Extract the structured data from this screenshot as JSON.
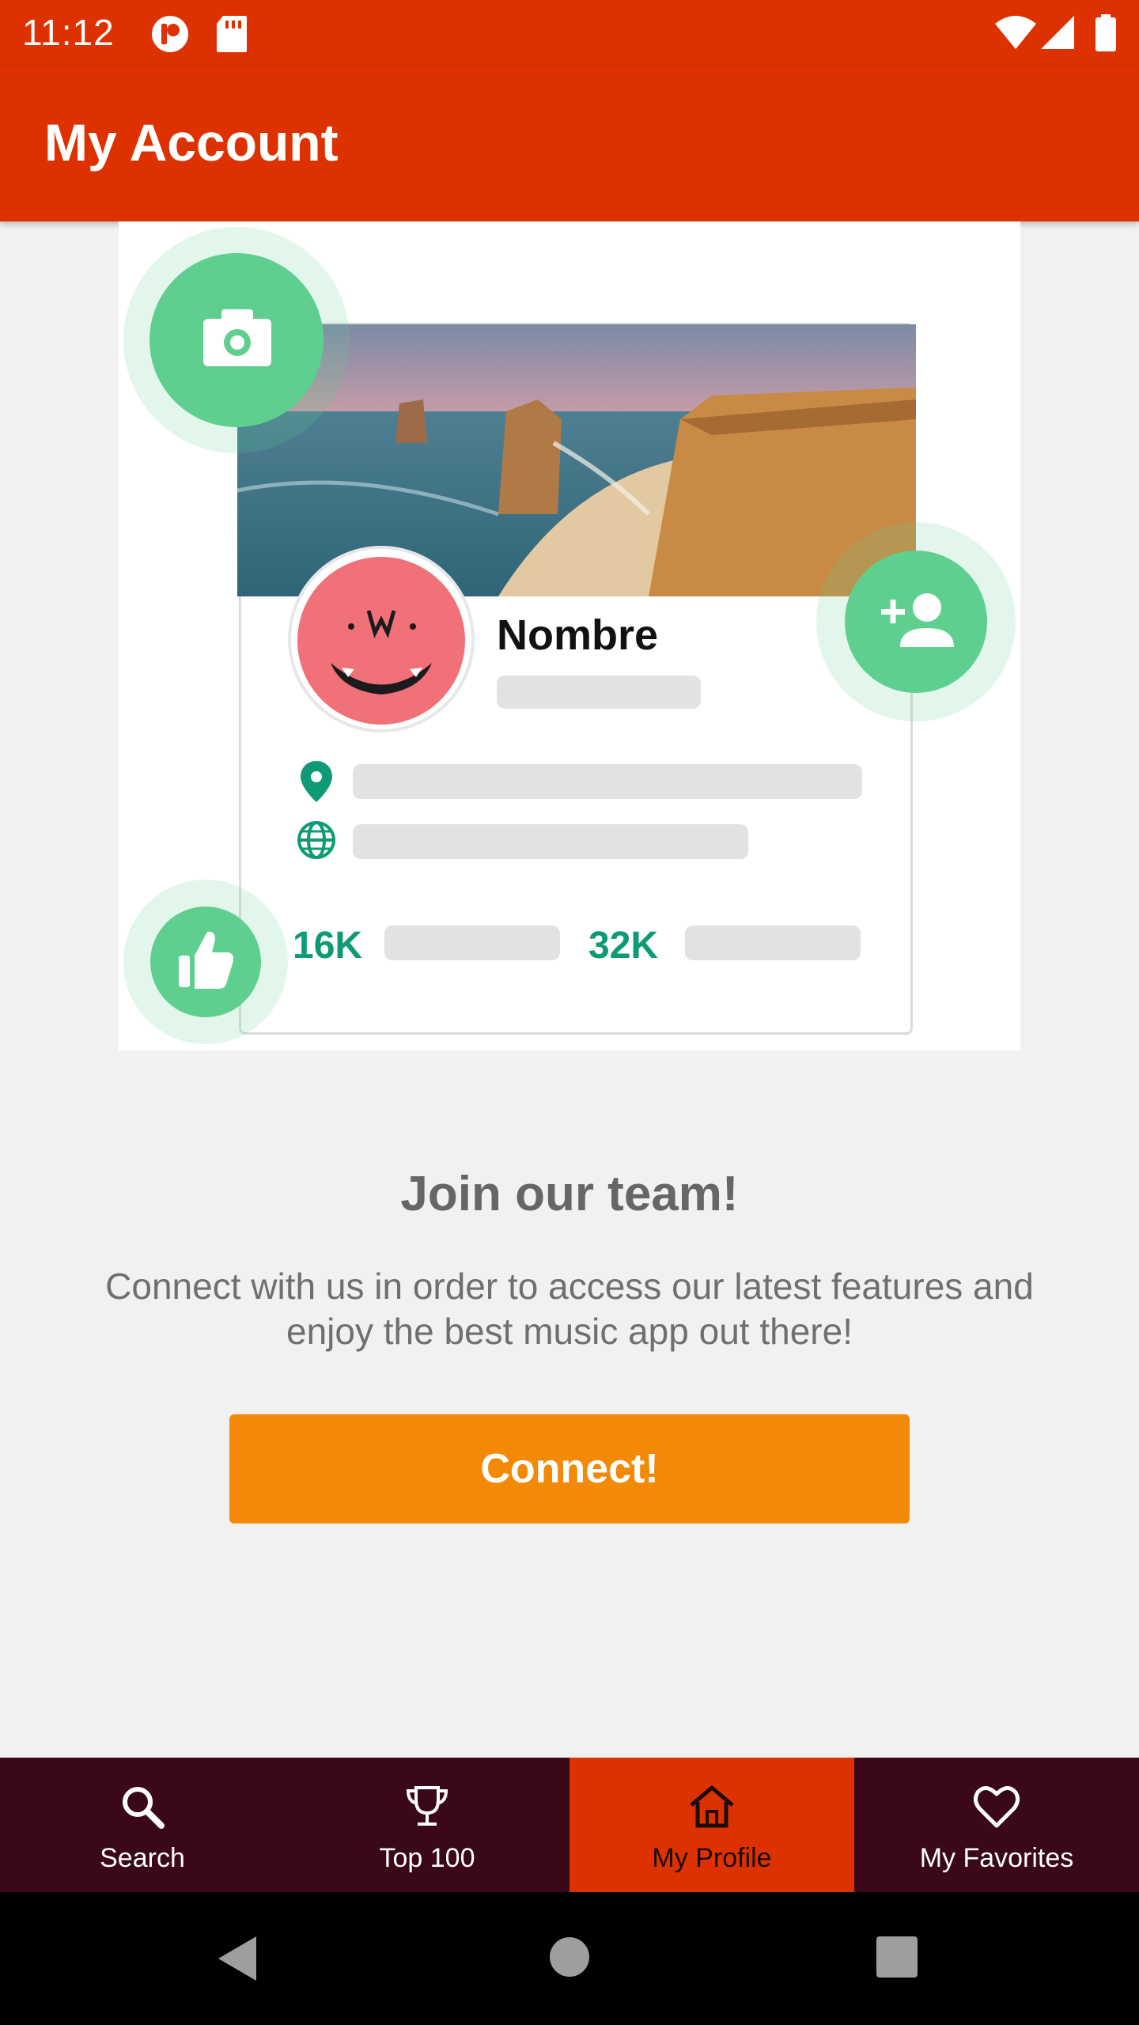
{
  "status_bar": {
    "time": "11:12",
    "icons": [
      "notification-p-icon",
      "sd-card-icon",
      "wifi-icon",
      "cellular-icon",
      "battery-icon"
    ]
  },
  "app_bar": {
    "title": "My Account"
  },
  "illustration": {
    "profile_name": "Nombre",
    "stat_1": "16K",
    "stat_2": "32K",
    "icons": [
      "camera-icon",
      "add-person-icon",
      "thumbs-up-icon",
      "location-pin-icon",
      "globe-icon"
    ]
  },
  "join": {
    "title": "Join our team!",
    "description": "Connect with us in order to access our latest features and enjoy the best music app out there!"
  },
  "connect_button": {
    "label": "Connect!"
  },
  "bottom_nav": {
    "items": [
      {
        "label": "Search",
        "icon": "search-icon",
        "active": false
      },
      {
        "label": "Top 100",
        "icon": "trophy-icon",
        "active": false
      },
      {
        "label": "My Profile",
        "icon": "home-icon",
        "active": true
      },
      {
        "label": "My Favorites",
        "icon": "heart-icon",
        "active": false
      }
    ]
  },
  "system_nav": {
    "icons": [
      "back-icon",
      "home-circle-icon",
      "recents-icon"
    ]
  },
  "colors": {
    "primary": "#dd3200",
    "accent": "#f28a07",
    "nav_background": "#3a0818",
    "illustration_green": "#5fcf8f"
  }
}
